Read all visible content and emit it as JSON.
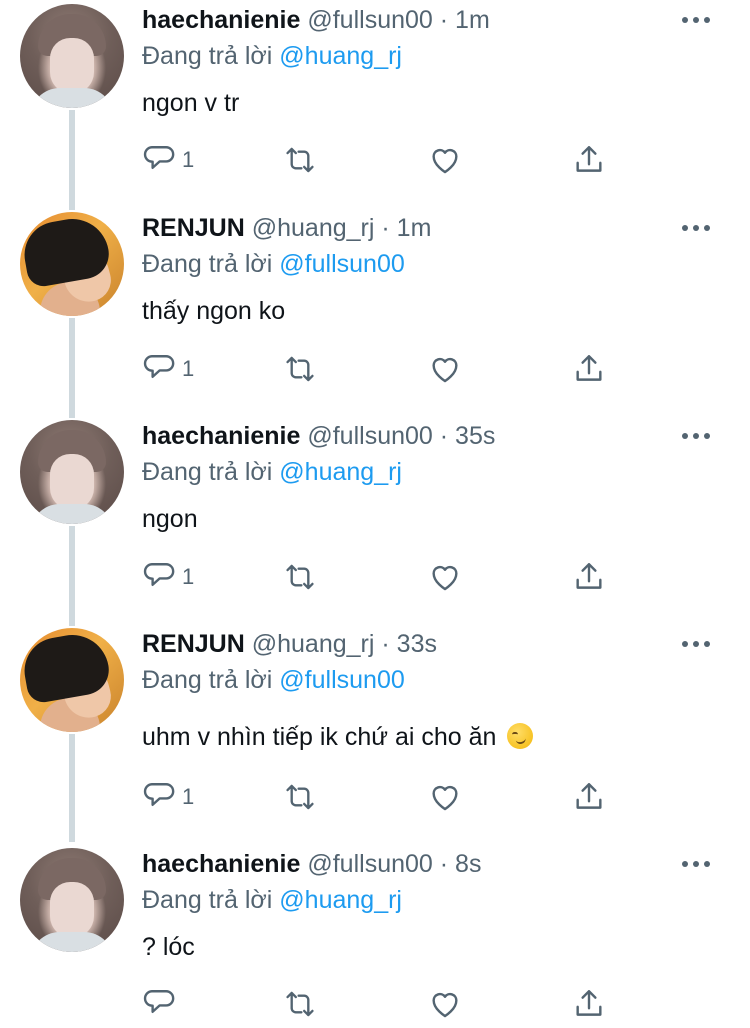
{
  "tweets": [
    {
      "author": "haechanienie",
      "handle": "@fullsun00",
      "separator": "·",
      "time": "1m",
      "reply_prefix": "Đang trả lời",
      "reply_to": "@huang_rj",
      "text": "ngon v tr",
      "reply_count": "1",
      "avatar": "haechan-avatar"
    },
    {
      "author": "RENJUN",
      "handle": "@huang_rj",
      "separator": "·",
      "time": "1m",
      "reply_prefix": "Đang trả lời",
      "reply_to": "@fullsun00",
      "text": "thấy ngon ko",
      "reply_count": "1",
      "avatar": "renjun-avatar"
    },
    {
      "author": "haechanienie",
      "handle": "@fullsun00",
      "separator": "·",
      "time": "35s",
      "reply_prefix": "Đang trả lời",
      "reply_to": "@huang_rj",
      "text": "ngon",
      "reply_count": "1",
      "avatar": "haechan-avatar"
    },
    {
      "author": "RENJUN",
      "handle": "@huang_rj",
      "separator": "·",
      "time": "33s",
      "reply_prefix": "Đang trả lời",
      "reply_to": "@fullsun00",
      "text": "uhm v nhìn tiếp ik chứ ai cho ăn",
      "emoji": "smirking-face",
      "reply_count": "1",
      "avatar": "renjun-avatar"
    },
    {
      "author": "haechanienie",
      "handle": "@fullsun00",
      "separator": "·",
      "time": "8s",
      "reply_prefix": "Đang trả lời",
      "reply_to": "@huang_rj",
      "text": "? lóc",
      "reply_count": "",
      "avatar": "haechan-avatar"
    }
  ],
  "icons": {
    "reply": "reply-icon",
    "retweet": "retweet-icon",
    "like": "like-icon",
    "share": "share-icon",
    "more": "more-icon"
  },
  "colors": {
    "link": "#1d9bf0",
    "secondary_text": "#536471",
    "primary_text": "#0f1419",
    "thread_line": "#cfd9de"
  }
}
